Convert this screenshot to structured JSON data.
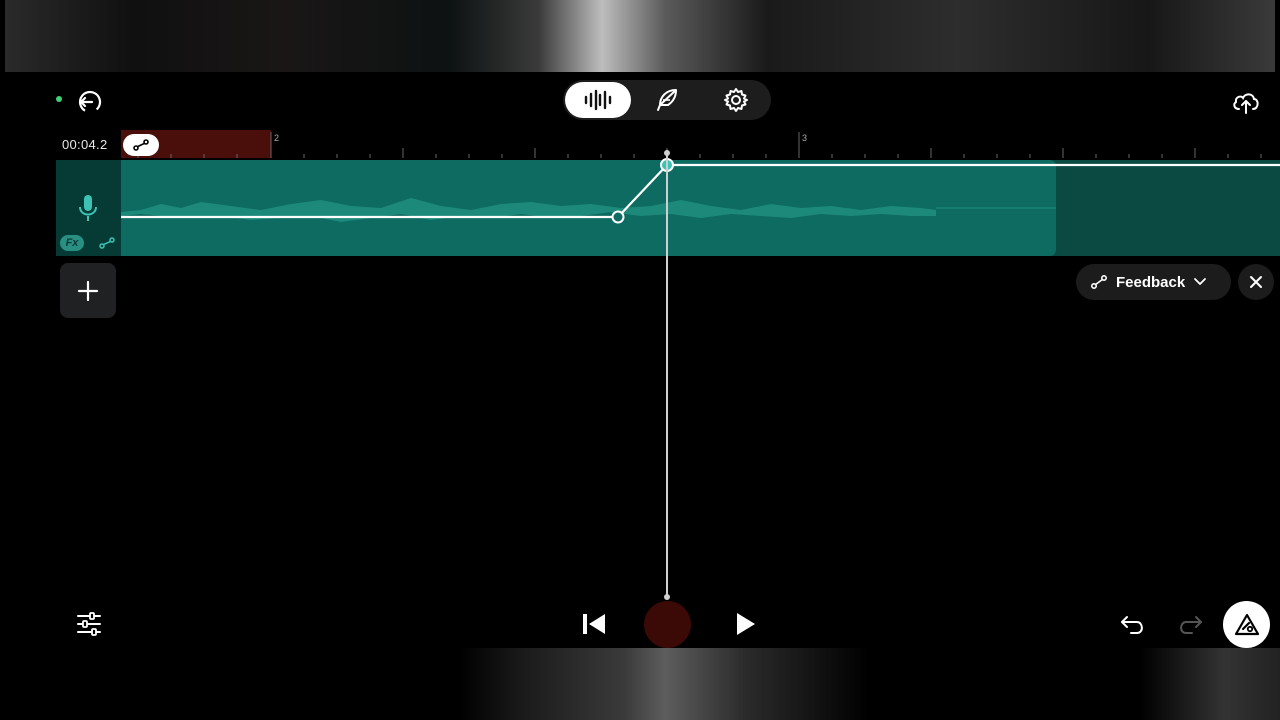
{
  "app": {
    "timecode": "00:04.2",
    "ruler_marks": [
      "2",
      "3"
    ],
    "accent": "#0d6b61",
    "record_color": "#3b0a07"
  },
  "header": {
    "modes": [
      {
        "icon": "waveform-icon",
        "active": true
      },
      {
        "icon": "feather-icon",
        "active": false
      },
      {
        "icon": "gear-icon",
        "active": false
      }
    ]
  },
  "track": {
    "fx_label": "Fx",
    "icon": "microphone-icon"
  },
  "automation": {
    "label": "Feedback"
  }
}
